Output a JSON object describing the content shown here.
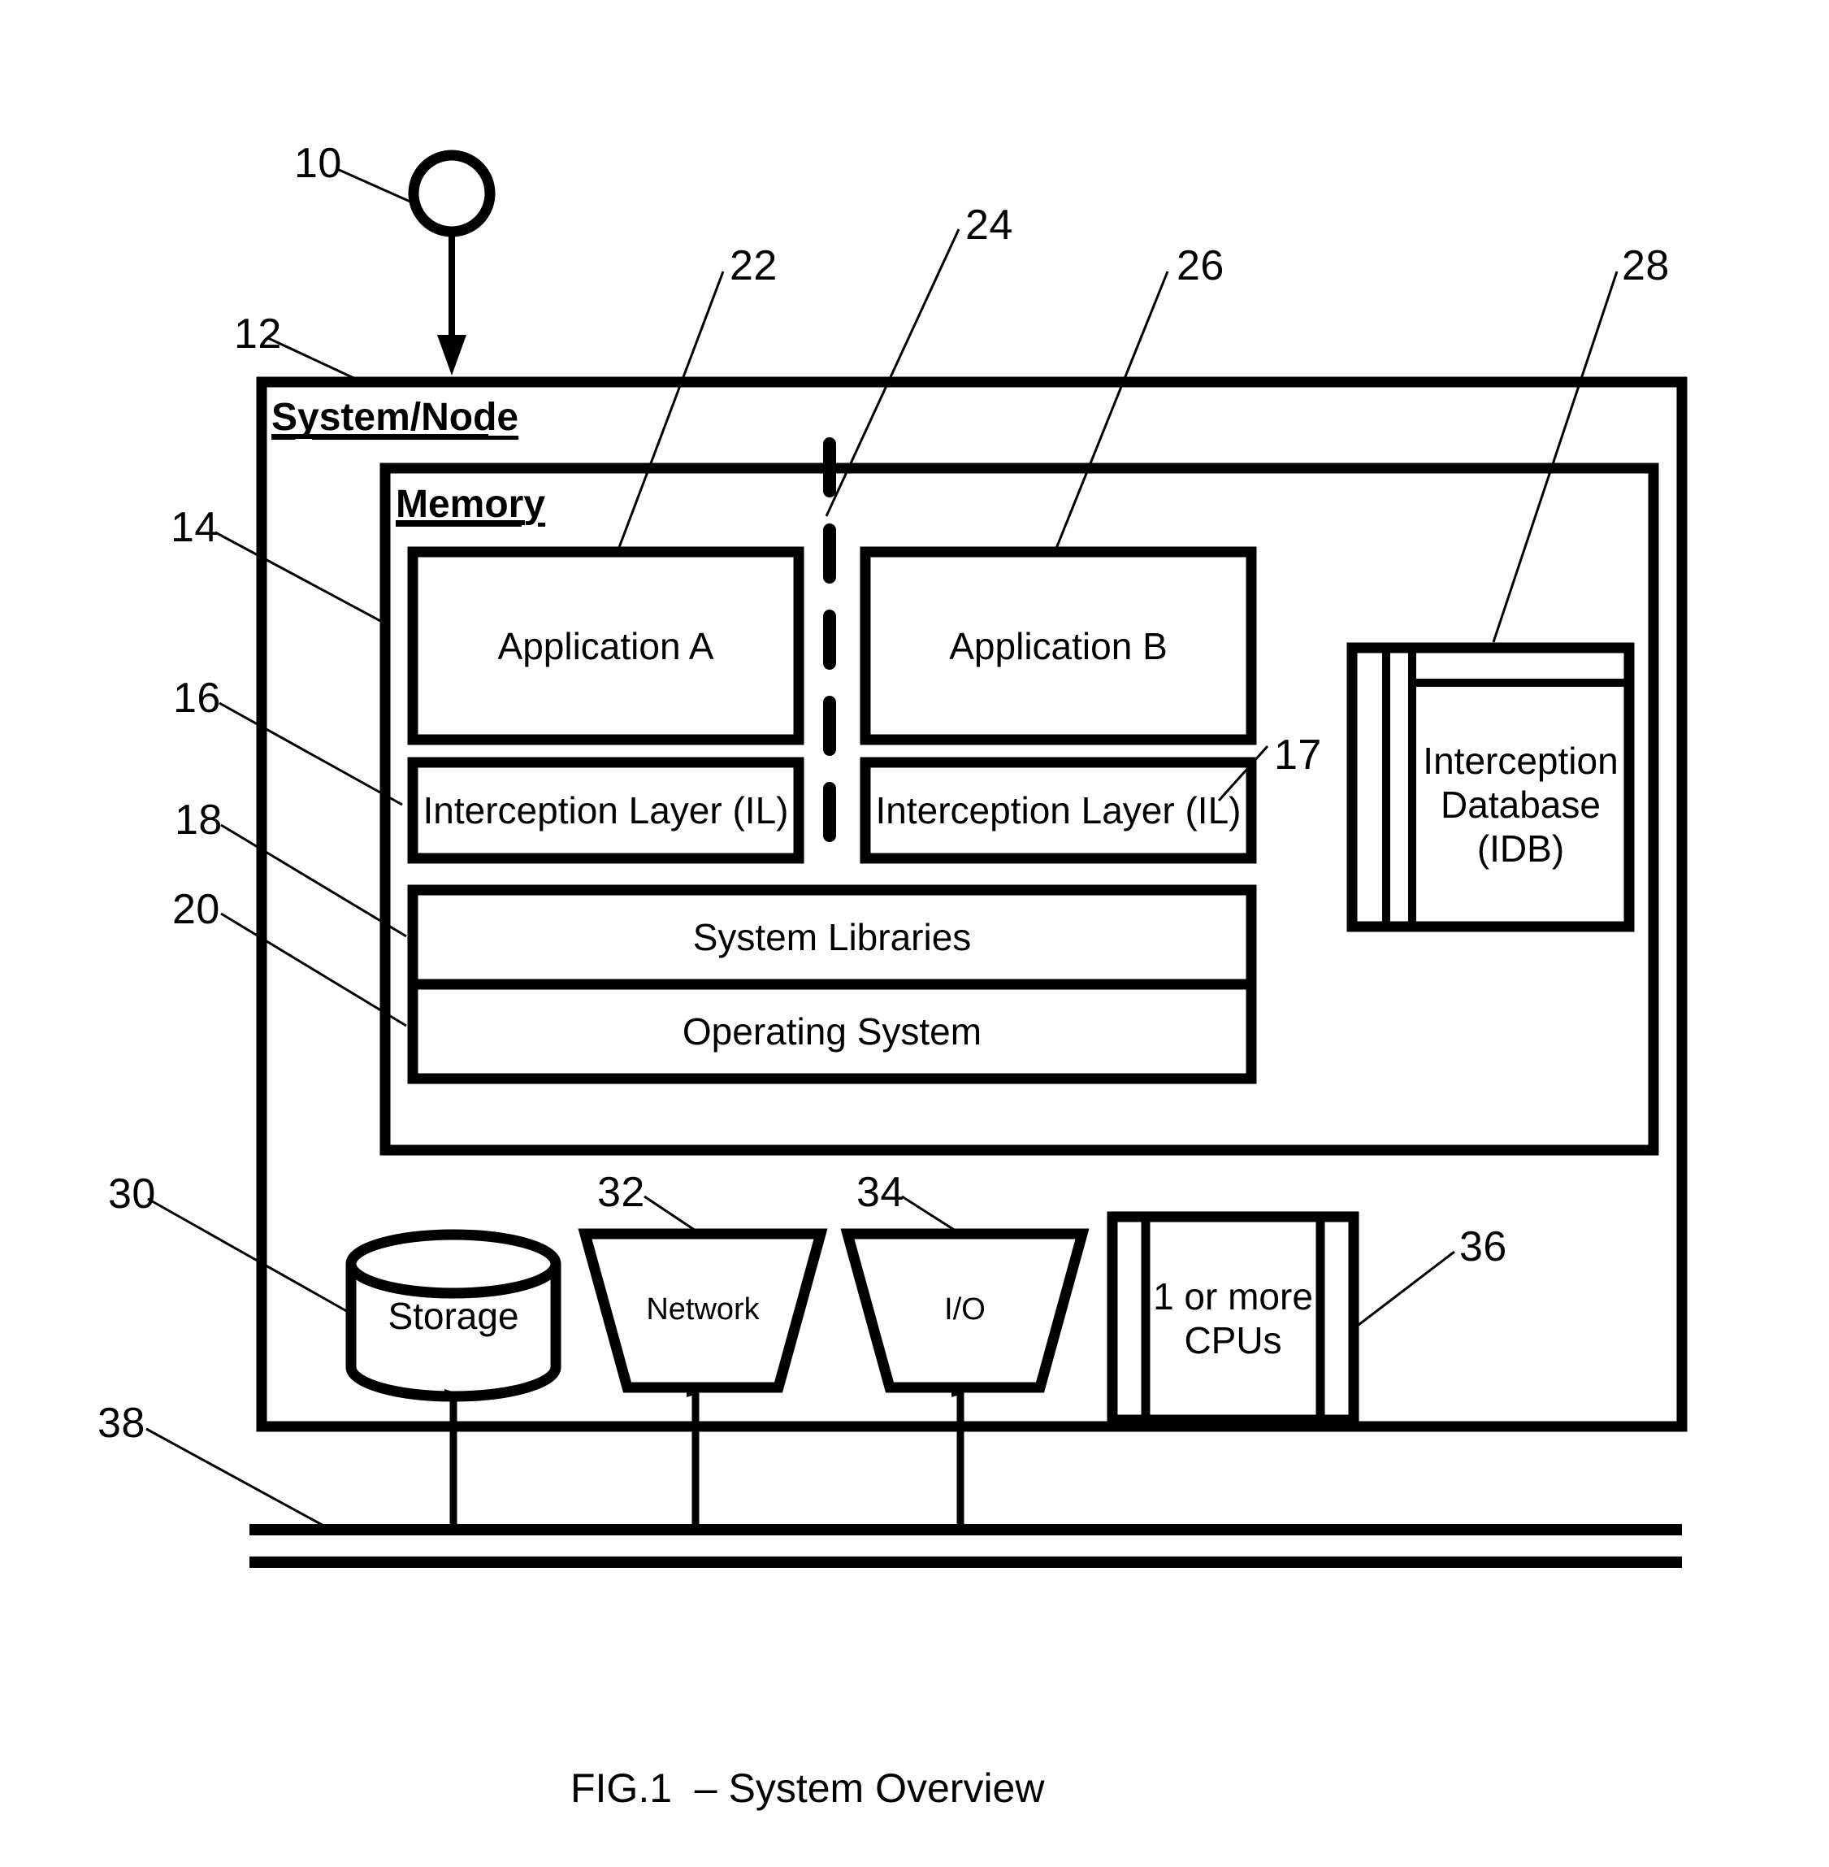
{
  "figure": {
    "caption": "FIG.1  – System Overview",
    "title": "System Overview",
    "number": "FIG.1"
  },
  "containers": {
    "system_node": {
      "title": "System/Node",
      "ref": "12"
    },
    "memory": {
      "title": "Memory",
      "ref": "14"
    }
  },
  "blocks": {
    "application_a": {
      "label": "Application A",
      "ref": "22"
    },
    "application_b": {
      "label": "Application B",
      "ref": "26"
    },
    "interception_layer_a": {
      "label": "Interception Layer (IL)",
      "ref": "16"
    },
    "interception_layer_b": {
      "label": "Interception Layer (IL)",
      "ref": "17"
    },
    "system_libraries": {
      "label": "System Libraries",
      "ref": "18"
    },
    "operating_system": {
      "label": "Operating System",
      "ref": "20"
    },
    "interception_database": {
      "label_line1": "Interception",
      "label_line2": "Database",
      "label_line3": "(IDB)",
      "ref": "28"
    },
    "storage": {
      "label": "Storage",
      "ref": "30"
    },
    "network": {
      "label": "Network",
      "ref": "32"
    },
    "io": {
      "label": "I/O",
      "ref": "34"
    },
    "cpus": {
      "label_line1": "1 or more",
      "label_line2": "CPUs",
      "ref": "36"
    },
    "bus": {
      "ref": "38"
    },
    "separator": {
      "ref": "24"
    },
    "entry_marker": {
      "ref": "10"
    }
  },
  "ref_numbers": {
    "n10": "10",
    "n12": "12",
    "n14": "14",
    "n16": "16",
    "n17": "17",
    "n18": "18",
    "n20": "20",
    "n22": "22",
    "n24": "24",
    "n26": "26",
    "n28": "28",
    "n30": "30",
    "n32": "32",
    "n34": "34",
    "n36": "36",
    "n38": "38"
  },
  "style": {
    "ink": "#000000",
    "paper": "#ffffff"
  },
  "diagram_data": {
    "type": "block-diagram",
    "hierarchy": [
      {
        "name": "System/Node",
        "ref": "12",
        "children": [
          {
            "name": "Memory",
            "ref": "14",
            "children": [
              {
                "name": "Application A",
                "ref": "22"
              },
              {
                "name": "Application B",
                "ref": "26"
              },
              {
                "name": "Interception Layer (IL)",
                "ref": "16"
              },
              {
                "name": "Interception Layer (IL)",
                "ref": "17"
              },
              {
                "name": "System Libraries",
                "ref": "18"
              },
              {
                "name": "Operating System",
                "ref": "20"
              },
              {
                "name": "Interception Database (IDB)",
                "ref": "28"
              },
              {
                "name": "process separation (dashed line)",
                "ref": "24"
              }
            ]
          },
          {
            "name": "Storage",
            "ref": "30"
          },
          {
            "name": "Network",
            "ref": "32"
          },
          {
            "name": "I/O",
            "ref": "34"
          },
          {
            "name": "1 or more CPUs",
            "ref": "36"
          }
        ]
      },
      {
        "name": "Bus",
        "ref": "38"
      }
    ],
    "connections": [
      {
        "from": "Storage",
        "to": "Bus",
        "arrow": "double"
      },
      {
        "from": "Network",
        "to": "Bus",
        "arrow": "double"
      },
      {
        "from": "I/O",
        "to": "Bus",
        "arrow": "double"
      },
      {
        "from": "entry marker 10",
        "to": "System/Node",
        "arrow": "single"
      }
    ]
  }
}
